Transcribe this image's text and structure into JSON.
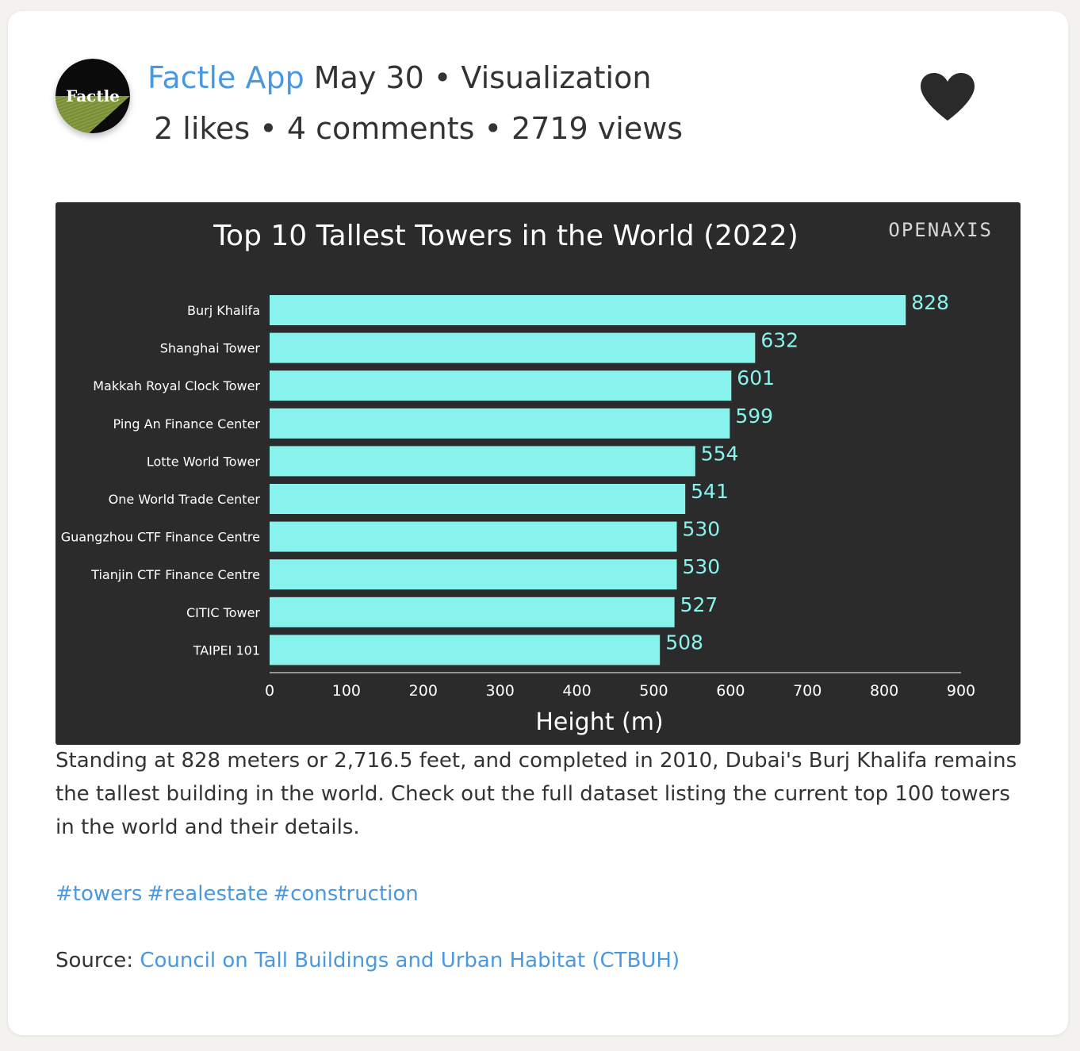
{
  "post": {
    "author": "Factle App",
    "avatar_text": "Factle",
    "date": "May 30",
    "category": "Visualization",
    "likes": "2 likes",
    "comments": "4 comments",
    "views": "2719 views",
    "separator": "•"
  },
  "caption": "Standing at 828 meters or 2,716.5 feet, and completed in 2010, Dubai's Burj Khalifa remains the tallest building in the world. Check out the full dataset listing the current top 100 towers in the world and their details.",
  "hashtags": [
    "#towers",
    "#realestate",
    "#construction"
  ],
  "source": {
    "label": "Source:",
    "link_text": "Council on Tall Buildings and Urban Habitat (CTBUH)"
  },
  "colors": {
    "accent": "#4a98e0",
    "bar": "#88f2ec",
    "chart_bg": "#2b2b2b"
  },
  "chart_data": {
    "type": "bar",
    "orientation": "horizontal",
    "title": "Top 10 Tallest Towers in the World (2022)",
    "brand": "OPENAXIS",
    "xlabel": "Height (m)",
    "ylabel": "",
    "xlim": [
      0,
      900
    ],
    "xticks": [
      0,
      100,
      200,
      300,
      400,
      500,
      600,
      700,
      800,
      900
    ],
    "grid": false,
    "categories": [
      "Burj Khalifa",
      "Shanghai Tower",
      "Makkah Royal Clock Tower",
      "Ping An Finance Center",
      "Lotte World Tower",
      "One World Trade Center",
      "Guangzhou CTF Finance Centre",
      "Tianjin CTF Finance Centre",
      "CITIC Tower",
      "TAIPEI 101"
    ],
    "values": [
      828,
      632,
      601,
      599,
      554,
      541,
      530,
      530,
      527,
      508
    ]
  }
}
